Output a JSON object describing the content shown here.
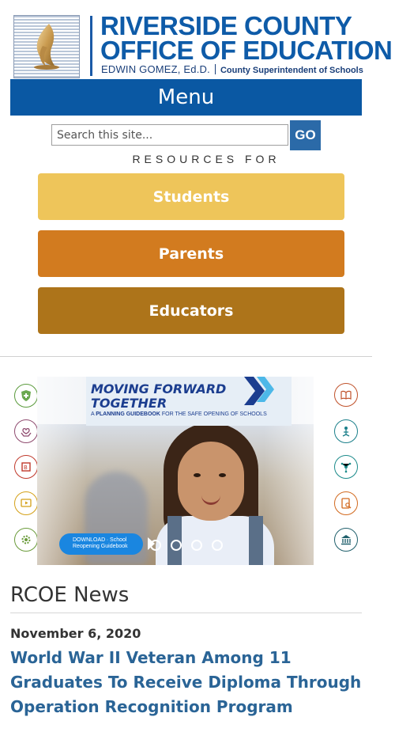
{
  "header": {
    "title_line1": "RIVERSIDE COUNTY",
    "title_line2": "OFFICE OF EDUCATION",
    "superintendent_name": "EDWIN GOMEZ, Ed.D.",
    "superintendent_role": "County Superintendent of Schools"
  },
  "menu": {
    "label": "Menu"
  },
  "search": {
    "placeholder": "Search this site...",
    "button_label": "GO"
  },
  "resources": {
    "label": "RESOURCES FOR",
    "buttons": [
      {
        "label": "Students",
        "color": "#eec55a"
      },
      {
        "label": "Parents",
        "color": "#d27b1f"
      },
      {
        "label": "Educators",
        "color": "#ad741a"
      }
    ]
  },
  "carousel": {
    "title_line1": "MOVING FORWARD",
    "title_line2": "TOGETHER",
    "subtitle_prefix": "A ",
    "subtitle_bold": "PLANNING GUIDEBOOK",
    "subtitle_suffix": " FOR THE SAFE OPENING OF SCHOOLS",
    "download_line1": "DOWNLOAD ∙ School",
    "download_line2": "Reopening Guidebook",
    "slide_count": 4,
    "left_icons": [
      "health-shield-icon",
      "care-hands-icon",
      "abc-blocks-icon",
      "video-play-icon",
      "settings-gear-icon"
    ],
    "right_icons": [
      "open-book-icon",
      "people-network-icon",
      "share-network-icon",
      "clipboard-search-icon",
      "institution-icon"
    ]
  },
  "news": {
    "heading": "RCOE News",
    "date": "November 6, 2020",
    "headline": "World War II Veteran Among 11 Graduates To Receive Diploma Through Operation Recognition Program"
  },
  "colors": {
    "brand_blue": "#0a58a3",
    "link_blue": "#2a6496",
    "students": "#eec55a",
    "parents": "#d27b1f",
    "educators": "#ad741a"
  }
}
